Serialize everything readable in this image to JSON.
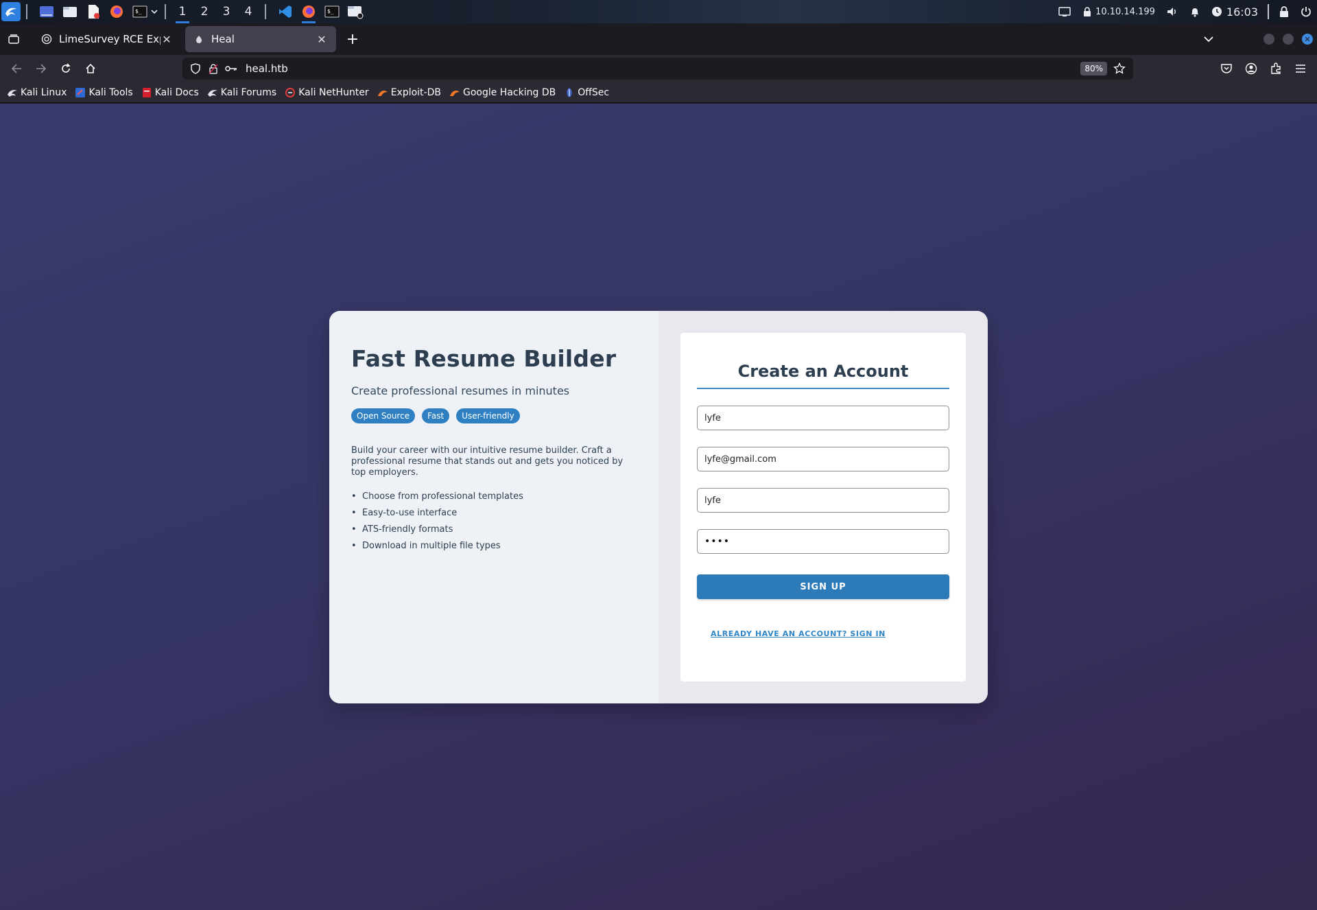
{
  "taskbar": {
    "workspaces": [
      "1",
      "2",
      "3",
      "4"
    ],
    "active_workspace": "1",
    "ip": "10.10.14.199",
    "clock": "16:03"
  },
  "tabs": [
    {
      "title": "LimeSurvey RCE Exploit",
      "active": false
    },
    {
      "title": "Heal",
      "active": true
    }
  ],
  "nav": {
    "url": "heal.htb",
    "zoom": "80%"
  },
  "bookmarks": [
    {
      "label": "Kali Linux",
      "icon": "kali-dragon-icon"
    },
    {
      "label": "Kali Tools",
      "icon": "kali-tools-icon"
    },
    {
      "label": "Kali Docs",
      "icon": "kali-docs-icon"
    },
    {
      "label": "Kali Forums",
      "icon": "kali-dragon-icon"
    },
    {
      "label": "Kali NetHunter",
      "icon": "nethunter-icon"
    },
    {
      "label": "Exploit-DB",
      "icon": "exploit-db-icon"
    },
    {
      "label": "Google Hacking DB",
      "icon": "ghdb-icon"
    },
    {
      "label": "OffSec",
      "icon": "offsec-icon"
    }
  ],
  "hero": {
    "title": "Fast Resume Builder",
    "subtitle": "Create professional resumes in minutes",
    "tags": [
      "Open Source",
      "Fast",
      "User-friendly"
    ],
    "intro": "Build your career with our intuitive resume builder. Craft a professional resume that stands out and gets you noticed by top employers.",
    "features": [
      "Choose from professional templates",
      "Easy-to-use interface",
      "ATS-friendly formats",
      "Download in multiple file types"
    ]
  },
  "form": {
    "title": "Create an Account",
    "fullname": "lyfe",
    "email": "lyfe@gmail.com",
    "username": "lyfe",
    "password_mask": "••••",
    "submit_label": "SIGN UP",
    "signin_label": "ALREADY HAVE AN ACCOUNT? SIGN IN"
  },
  "colors": {
    "accent": "#2d7ab8",
    "tag": "#2f80c2",
    "page_bg": "#363665",
    "heading": "#2c3e50"
  }
}
